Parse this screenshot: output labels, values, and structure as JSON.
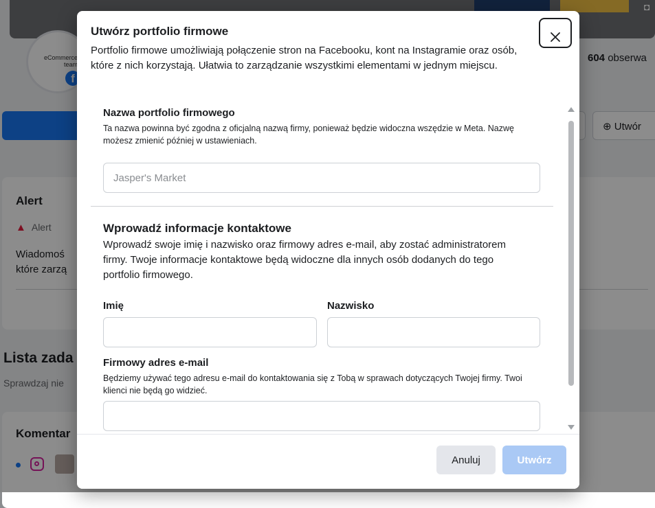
{
  "background": {
    "avatar_text": "eCommerce team",
    "followers_count": "604",
    "followers_label": "obserwa",
    "create_button": "Utwór",
    "alert_title": "Alert",
    "alert_sub": "Alert",
    "alert_text_line1": "Wiadomoś",
    "alert_text_line2": "które zarzą",
    "list_title": "Lista zada",
    "list_sub": "Sprawdzaj nie",
    "comments_title": "Komentar"
  },
  "modal": {
    "title": "Utwórz portfolio firmowe",
    "description": "Portfolio firmowe umożliwiają połączenie stron na Facebooku, kont na Instagramie oraz osób, które z nich korzystają. Ułatwia to zarządzanie wszystkimi elementami w jednym miejscu.",
    "business_name": {
      "label": "Nazwa portfolio firmowego",
      "help": "Ta nazwa powinna być zgodna z oficjalną nazwą firmy, ponieważ będzie widoczna wszędzie w Meta. Nazwę możesz zmienić później w ustawieniach.",
      "placeholder": "Jasper's Market",
      "value": ""
    },
    "contact": {
      "title": "Wprowadź informacje kontaktowe",
      "description": "Wprowadź swoje imię i nazwisko oraz firmowy adres e-mail, aby zostać administratorem firmy. Twoje informacje kontaktowe będą widoczne dla innych osób dodanych do tego portfolio firmowego.",
      "first_name_label": "Imię",
      "last_name_label": "Nazwisko",
      "email_label": "Firmowy adres e-mail",
      "email_help": "Będziemy używać tego adresu e-mail do kontaktowania się z Tobą w sprawach dotyczących Twojej firmy. Twoi klienci nie będą go widzieć."
    },
    "footer": {
      "cancel_label": "Anuluj",
      "create_label": "Utwórz"
    }
  },
  "colors": {
    "primary": "#1877f2",
    "create_disabled": "#aac9f5",
    "cancel_bg": "#e4e6eb"
  }
}
